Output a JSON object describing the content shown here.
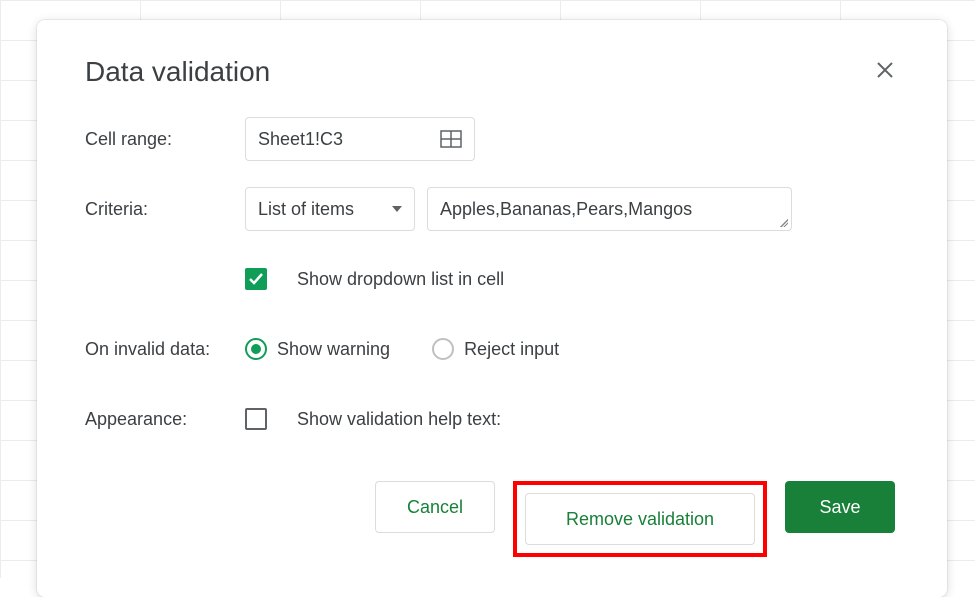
{
  "dialog": {
    "title": "Data validation",
    "cellRange": {
      "label": "Cell range:",
      "value": "Sheet1!C3"
    },
    "criteria": {
      "label": "Criteria:",
      "type": "List of items",
      "items": "Apples,Bananas,Pears,Mangos",
      "showDropdownLabel": "Show dropdown list in cell",
      "showDropdownChecked": true
    },
    "invalid": {
      "label": "On invalid data:",
      "showWarning": "Show warning",
      "rejectInput": "Reject input",
      "selected": "showWarning"
    },
    "appearance": {
      "label": "Appearance:",
      "helpTextLabel": "Show validation help text:",
      "helpTextChecked": false
    },
    "buttons": {
      "cancel": "Cancel",
      "remove": "Remove validation",
      "save": "Save"
    }
  }
}
